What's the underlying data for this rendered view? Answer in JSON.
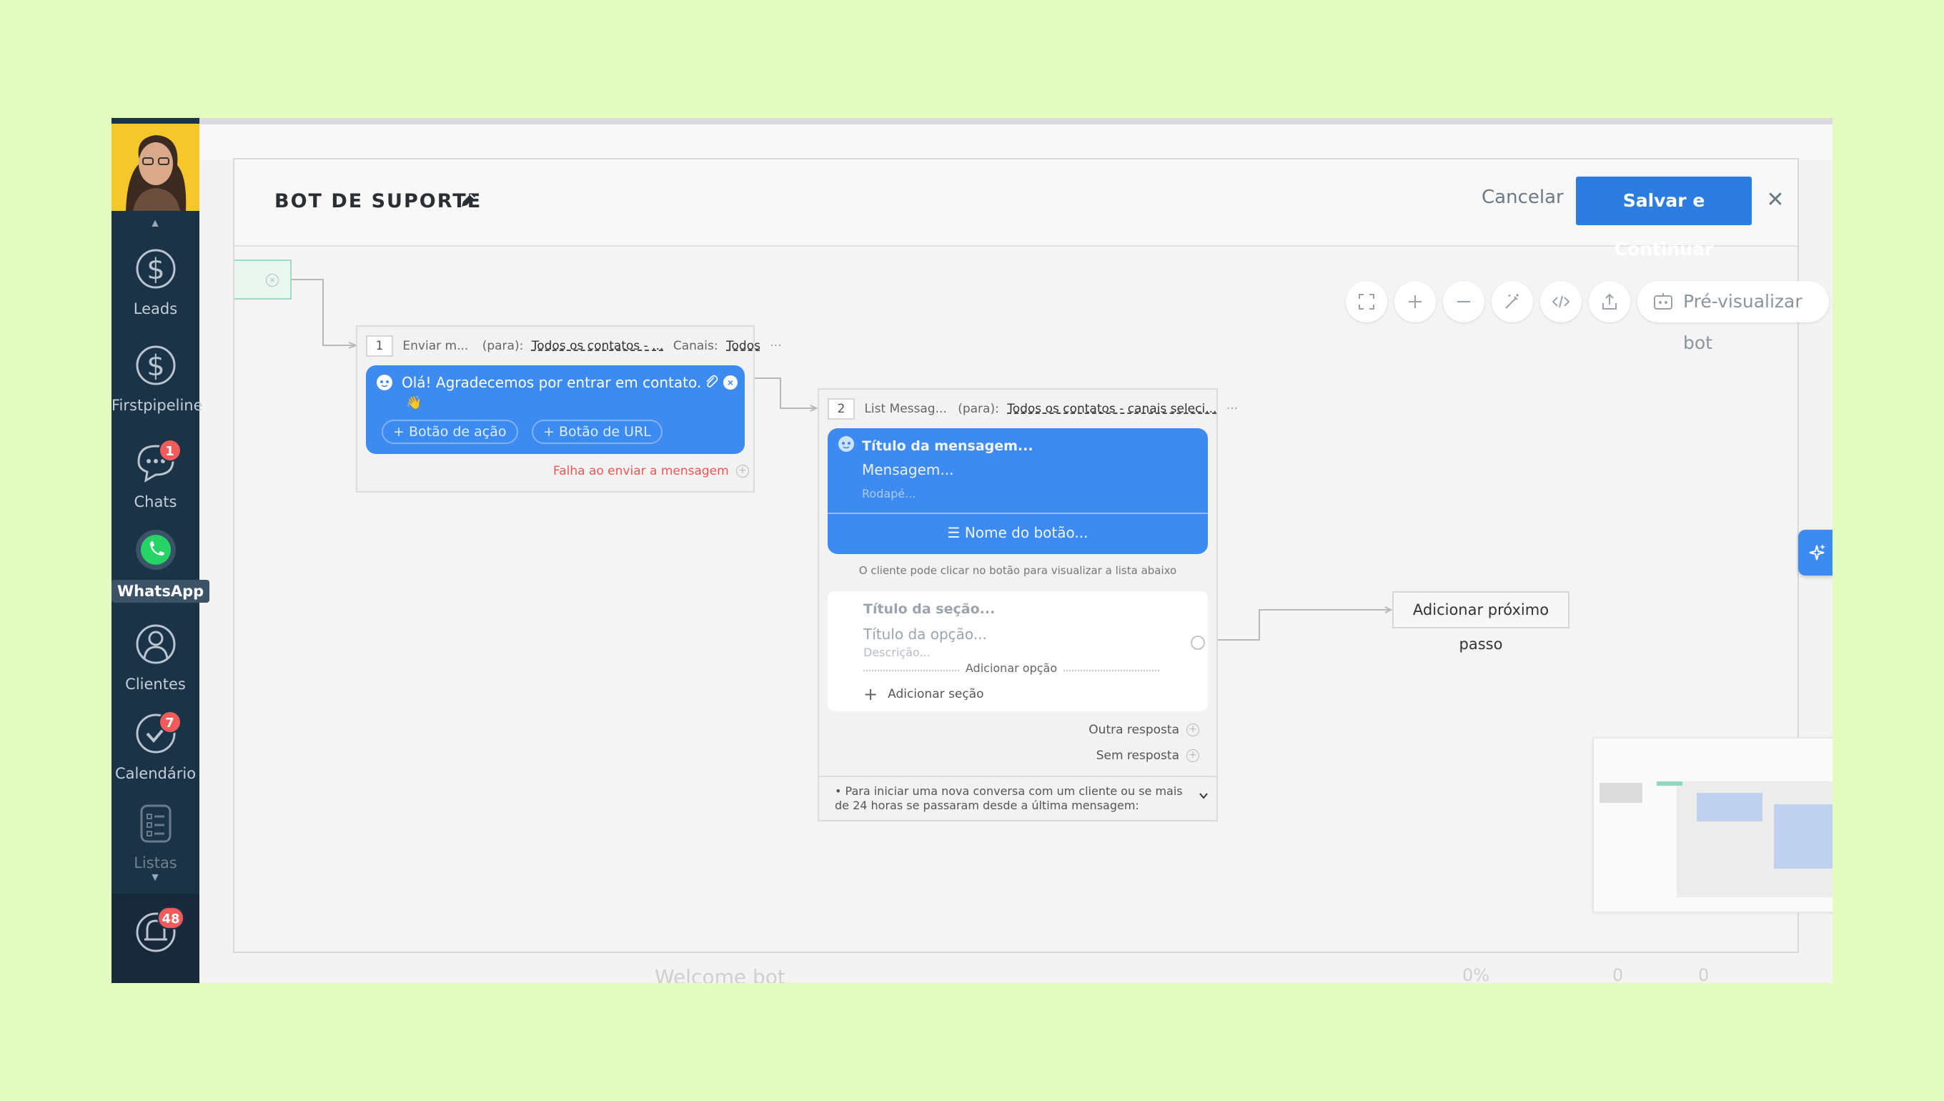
{
  "sidebar": {
    "items": [
      {
        "label": "Leads"
      },
      {
        "label": "Firstpipeline"
      },
      {
        "label": "Chats",
        "badge": "1"
      },
      {
        "label": "WhatsApp"
      },
      {
        "label": "Clientes"
      },
      {
        "label": "Calendário",
        "badge": "7"
      },
      {
        "label": "Listas"
      }
    ],
    "notifications_badge": "48"
  },
  "background": {
    "row_label": "Welcome bot",
    "row_values": [
      "0%",
      "0",
      "0"
    ]
  },
  "modal": {
    "title": "BOT DE SUPORTE",
    "cancel_label": "Cancelar",
    "save_label": "Salvar e Continuar"
  },
  "toolbar": {
    "preview_label": "Pré-visualizar bot",
    "icons": [
      "fullscreen-icon",
      "zoom-in-icon",
      "zoom-out-icon",
      "magic-wand-icon",
      "code-icon",
      "export-icon"
    ]
  },
  "step1": {
    "number": "1",
    "action": "Enviar m...",
    "to_label": "(para):",
    "to_value": "Todos os contatos - ...",
    "channels_label": "Canais:",
    "channels_value": "Todos",
    "message": "Olá! Agradecemos por entrar em contato.",
    "emoji": "👋",
    "action_button": "+ Botão de ação",
    "url_button": "+ Botão de URL",
    "fail_label": "Falha ao enviar a mensagem"
  },
  "step2": {
    "number": "2",
    "action": "List Messag...",
    "to_label": "(para):",
    "to_value": "Todos os contatos - canais seleci...",
    "msg_title": "Título da mensagem...",
    "msg_body": "Mensagem...",
    "msg_footer": "Rodapé...",
    "button_name": "Nome do botão...",
    "list_note": "O cliente pode clicar no botão para visualizar a lista abaixo",
    "section_title": "Título da seção...",
    "option_title": "Título da opção...",
    "option_desc": "Descrição...",
    "add_option": "Adicionar opção",
    "add_section": "Adicionar seção",
    "other_response": "Outra resposta",
    "no_response": "Sem resposta",
    "note": "Para iniciar uma nova conversa com um cliente ou se mais de 24 horas se passaram desde a última mensagem:"
  },
  "next_step_label": "Adicionar próximo passo",
  "colors": {
    "accent": "#2d7de0",
    "message_bubble": "#3d8bf0",
    "sidebar": "#1b3346",
    "badge": "#f15b5b",
    "page_bg": "#e3fbbf"
  }
}
